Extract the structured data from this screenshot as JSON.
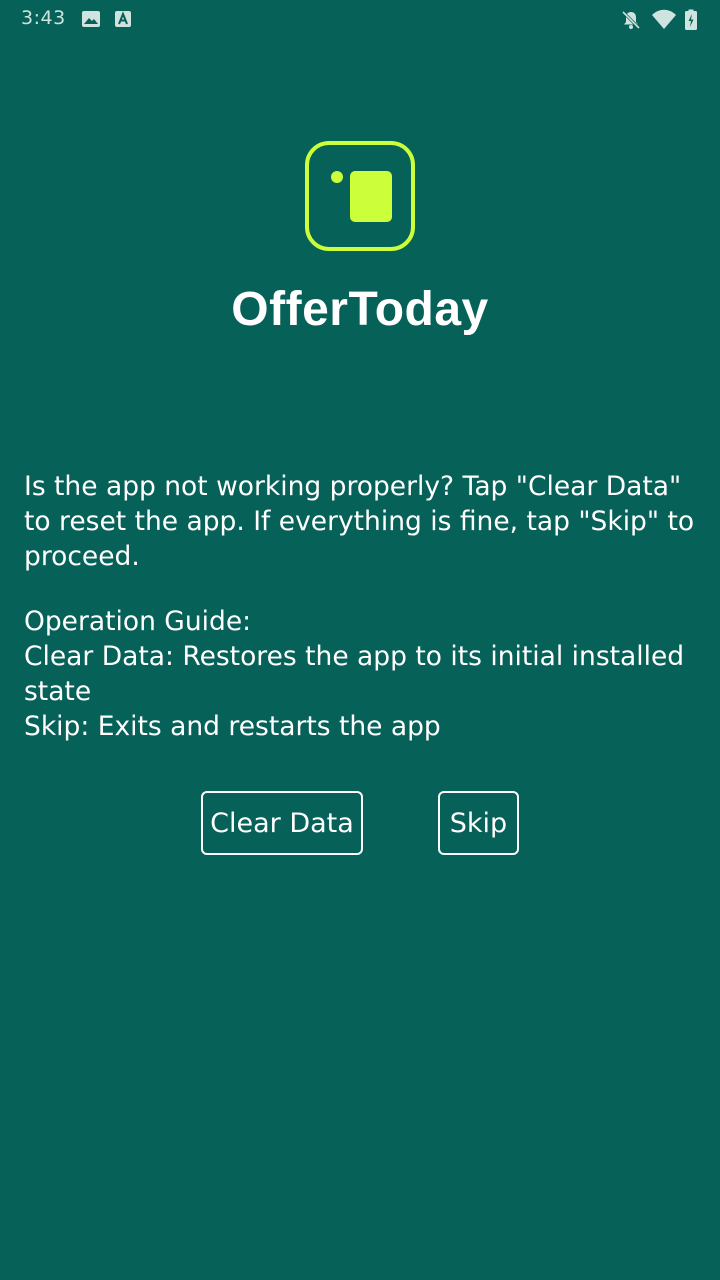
{
  "status_bar": {
    "time": "3:43",
    "left_icons": [
      "image-icon",
      "text-a-icon"
    ],
    "right_icons": [
      "notifications-off-icon",
      "wifi-icon",
      "battery-icon"
    ]
  },
  "app": {
    "name": "OfferToday",
    "logo_icon": "app-logo-icon",
    "accent_color": "#CCFF3A",
    "background_color": "#066158"
  },
  "message": "Is the app not working properly? Tap \"Clear Data\" to reset the app. If everything is fine, tap \"Skip\" to proceed.",
  "guide": {
    "heading": "Operation Guide:",
    "line_clear": "Clear Data: Restores the app to its initial installed state",
    "line_skip": "Skip: Exits and restarts the app"
  },
  "buttons": {
    "clear_label": "Clear Data",
    "skip_label": "Skip"
  }
}
